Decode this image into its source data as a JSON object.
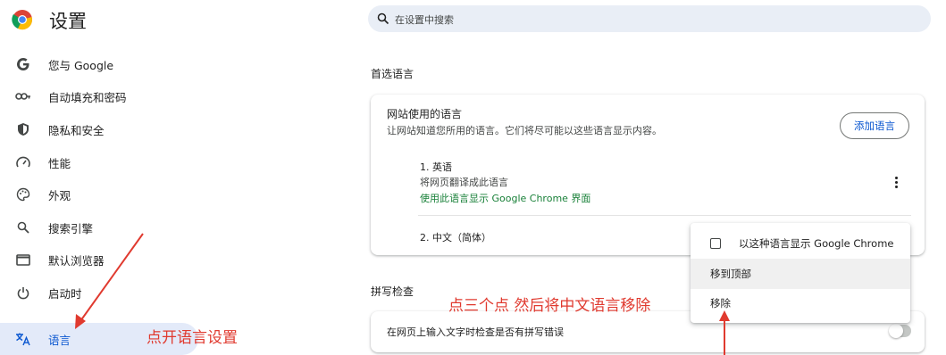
{
  "app": {
    "title": "设置"
  },
  "search": {
    "placeholder": "在设置中搜索"
  },
  "sidebar": {
    "items": [
      {
        "label": "您与 Google",
        "icon": "google-icon"
      },
      {
        "label": "自动填充和密码",
        "icon": "key-icon"
      },
      {
        "label": "隐私和安全",
        "icon": "shield-icon"
      },
      {
        "label": "性能",
        "icon": "speedometer-icon"
      },
      {
        "label": "外观",
        "icon": "palette-icon"
      },
      {
        "label": "搜索引擎",
        "icon": "search-icon"
      },
      {
        "label": "默认浏览器",
        "icon": "browser-icon"
      },
      {
        "label": "启动时",
        "icon": "power-icon"
      },
      {
        "label": "语言",
        "icon": "translate-icon",
        "active": true
      }
    ]
  },
  "main": {
    "preferred_languages": {
      "section_title": "首选语言",
      "card_title": "网站使用的语言",
      "card_subtitle": "让网站知道您所用的语言。它们将尽可能以这些语言显示内容。",
      "add_button": "添加语言",
      "languages": [
        {
          "name": "1. 英语",
          "line1": "将网页翻译成此语言",
          "line2": "使用此语言显示 Google Chrome 界面"
        },
        {
          "name": "2. 中文（简体）"
        }
      ]
    },
    "spellcheck": {
      "section_title": "拼写检查",
      "toggle_label": "在网页上输入文字时检查是否有拼写错误",
      "enabled": false
    }
  },
  "context_menu": {
    "items": [
      {
        "label": "以这种语言显示 Google Chrome",
        "checkbox": true,
        "checked": false
      },
      {
        "label": "移到顶部",
        "hovered": true
      },
      {
        "label": "移除"
      }
    ]
  },
  "annotations": {
    "left_note": "点开语言设置",
    "center_note": "点三个点 然后将中文语言移除"
  },
  "colors": {
    "accent": "#0b57d0",
    "annotation": "#e03a2f",
    "link_green": "#188038"
  }
}
